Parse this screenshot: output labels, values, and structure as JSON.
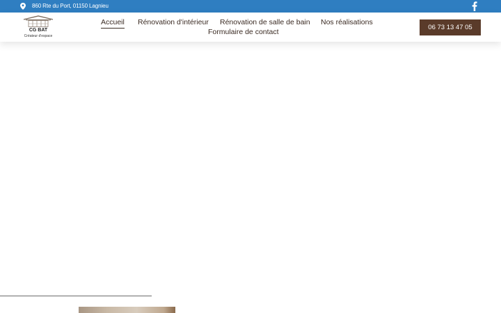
{
  "topbar": {
    "address": "860 Rte du Port, 01150 Lagnieu",
    "address_icon": "map-pin-icon",
    "social_icon": "facebook-icon",
    "background": "#2f7ec1"
  },
  "logo": {
    "brand": "CG BAT",
    "tagline": "Créateur d'espace"
  },
  "nav": {
    "items": [
      {
        "label": "Accueil",
        "active": true
      },
      {
        "label": "Rénovation d'intérieur",
        "active": false
      },
      {
        "label": "Rénovation de salle de bain",
        "active": false
      },
      {
        "label": "Nos réalisations",
        "active": false
      },
      {
        "label": "Formulaire de contact",
        "active": false
      }
    ]
  },
  "cta": {
    "phone": "06 73 13 47 05",
    "background": "#5a3b2a"
  }
}
